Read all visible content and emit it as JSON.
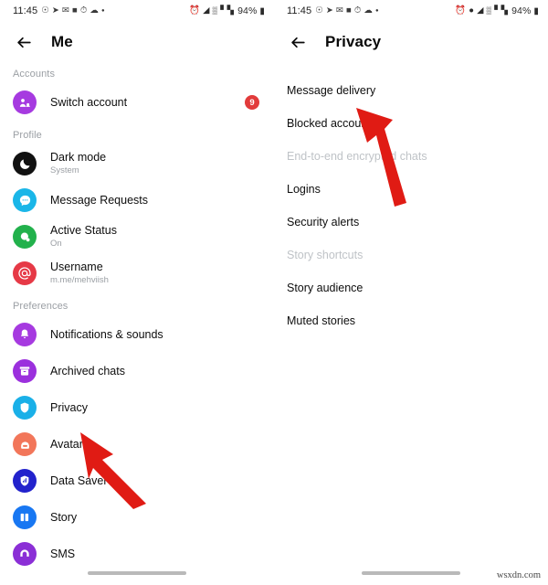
{
  "watermark": "wsxdn.com",
  "colors": {
    "badge_red": "#e23b3b",
    "arrow_red": "#e01b14",
    "purple": "#a63ae0",
    "deep_purple": "#8b2fd6",
    "cyan": "#1ab6e8",
    "green": "#22b14c",
    "red_icon": "#e63946",
    "light_blue": "#1ab0e8",
    "coral": "#f2765a",
    "indigo": "#2222cc",
    "blue": "#1877f2",
    "dark": "#111111",
    "muted_text": "#9b9fa4",
    "primary_text": "#0d0d0d"
  },
  "left_screen": {
    "status_bar": {
      "time": "11:45",
      "left_icons": [
        "whatsapp-icon",
        "telegram-icon",
        "mail-icon",
        "messenger-icon",
        "clock-app-icon",
        "cloud-icon",
        "dot-icon"
      ],
      "right_icons": [
        "alarm-icon",
        "wifi-icon",
        "signal-icon",
        "signal-bars-icon"
      ],
      "battery": "94%"
    },
    "appbar": {
      "back_icon": "back-arrow-icon",
      "title": "Me"
    },
    "sections": [
      {
        "header": "Accounts",
        "items": [
          {
            "icon": "switch-account-icon",
            "icon_color": "#a63ae0",
            "title": "Switch account",
            "subtitle": "",
            "badge": "9"
          }
        ]
      },
      {
        "header": "Profile",
        "items": [
          {
            "icon": "dark-mode-icon",
            "icon_color": "#111111",
            "title": "Dark mode",
            "subtitle": "System",
            "badge": ""
          },
          {
            "icon": "message-requests-icon",
            "icon_color": "#1ab6e8",
            "title": "Message Requests",
            "subtitle": "",
            "badge": ""
          },
          {
            "icon": "active-status-icon",
            "icon_color": "#22b14c",
            "title": "Active Status",
            "subtitle": "On",
            "badge": ""
          },
          {
            "icon": "username-icon",
            "icon_color": "#e63946",
            "title": "Username",
            "subtitle": "m.me/mehviish",
            "badge": ""
          }
        ]
      },
      {
        "header": "Preferences",
        "items": [
          {
            "icon": "notifications-icon",
            "icon_color": "#a63ae0",
            "title": "Notifications & sounds",
            "subtitle": "",
            "badge": ""
          },
          {
            "icon": "archived-chats-icon",
            "icon_color": "#9b30dd",
            "title": "Archived chats",
            "subtitle": "",
            "badge": ""
          },
          {
            "icon": "privacy-shield-icon",
            "icon_color": "#1ab0e8",
            "title": "Privacy",
            "subtitle": "",
            "badge": ""
          },
          {
            "icon": "avatar-icon",
            "icon_color": "#f2765a",
            "title": "Avatar",
            "subtitle": "",
            "badge": ""
          },
          {
            "icon": "data-saver-icon",
            "icon_color": "#2222cc",
            "title": "Data Saver",
            "subtitle": "",
            "badge": ""
          },
          {
            "icon": "story-icon",
            "icon_color": "#1877f2",
            "title": "Story",
            "subtitle": "",
            "badge": ""
          },
          {
            "icon": "sms-icon",
            "icon_color": "#8b2fd6",
            "title": "SMS",
            "subtitle": "",
            "badge": ""
          }
        ]
      }
    ],
    "annotation_arrow": "red-arrow-pointing-to-privacy"
  },
  "right_screen": {
    "status_bar": {
      "time": "11:45",
      "left_icons": [
        "whatsapp-icon",
        "telegram-icon",
        "mail-icon",
        "messenger-icon",
        "clock-app-icon",
        "cloud-icon",
        "dot-icon"
      ],
      "right_icons": [
        "alarm-icon",
        "location-pin-icon",
        "wifi-icon",
        "signal-icon",
        "signal-bars-icon"
      ],
      "battery": "94%"
    },
    "appbar": {
      "back_icon": "back-arrow-icon",
      "title": "Privacy"
    },
    "items": [
      {
        "label": "Message delivery",
        "type": "item"
      },
      {
        "label": "Blocked accounts",
        "type": "item"
      },
      {
        "label": "End-to-end encrypted chats",
        "type": "header"
      },
      {
        "label": "Logins",
        "type": "item"
      },
      {
        "label": "Security alerts",
        "type": "item"
      },
      {
        "label": "Story shortcuts",
        "type": "header"
      },
      {
        "label": "Story audience",
        "type": "item"
      },
      {
        "label": "Muted stories",
        "type": "item"
      }
    ],
    "annotation_arrow": "red-arrow-pointing-to-blocked-accounts"
  }
}
